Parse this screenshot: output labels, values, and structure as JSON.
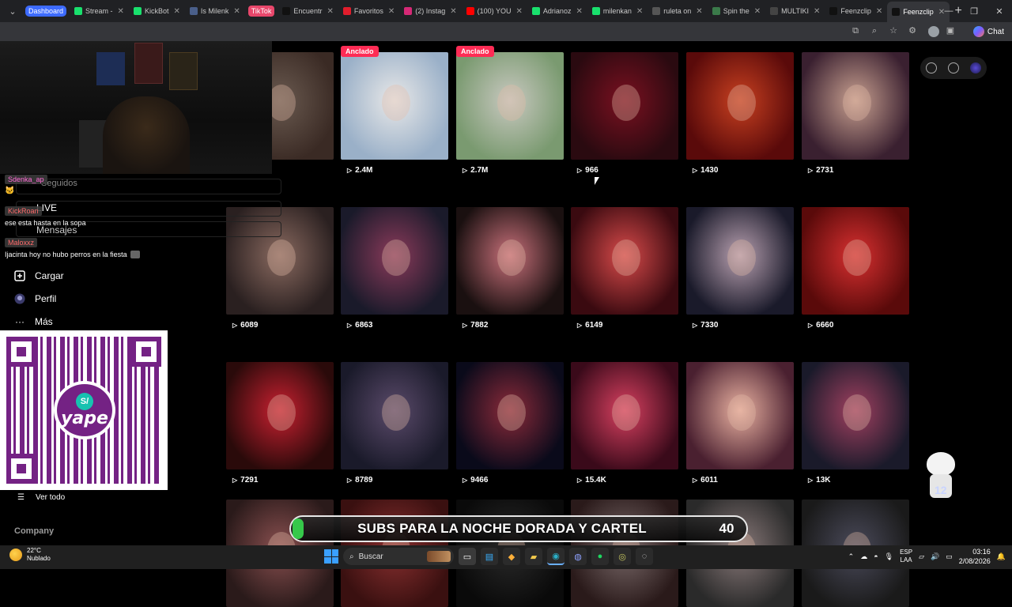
{
  "browser": {
    "tabs": [
      {
        "label": "Dashboard",
        "kind": "group",
        "color": "#3d6bff"
      },
      {
        "label": "Stream -",
        "fav": "#19e06d"
      },
      {
        "label": "KickBot",
        "fav": "#19e06d"
      },
      {
        "label": "Is Milenk",
        "fav": "#4a5f8a"
      },
      {
        "label": "TikTok",
        "kind": "tiktok",
        "color": "#e8476b"
      },
      {
        "label": "Encuentr",
        "fav": "#111111"
      },
      {
        "label": "Favoritos",
        "fav": "#e11d2c"
      },
      {
        "label": "(2) Instag",
        "fav": "#d62976"
      },
      {
        "label": "(100) YOU",
        "fav": "#ff0000"
      },
      {
        "label": "Adrianoz",
        "fav": "#19e06d"
      },
      {
        "label": "milenkan",
        "fav": "#19e06d"
      },
      {
        "label": "ruleta on",
        "fav": "#555555"
      },
      {
        "label": "Spin the",
        "fav": "#3b7a4a"
      },
      {
        "label": "MULTIKI",
        "fav": "#444444"
      },
      {
        "label": "Feenzclip",
        "fav": "#111111"
      },
      {
        "label": "Feenzclip",
        "fav": "#111111",
        "active": true
      }
    ],
    "toolbar": {
      "chat_label": "Chat"
    }
  },
  "sidebar": {
    "ghost_labels": [
      "Seguidos",
      "LIVE",
      "Mensajes"
    ],
    "items": [
      {
        "label": "Cargar",
        "icon": "plus-square-icon"
      },
      {
        "label": "Perfil",
        "icon": "avatar-icon"
      },
      {
        "label": "Más",
        "icon": "more-icon"
      }
    ],
    "see_all": "Ver todo",
    "company": "Company"
  },
  "stream_chat": [
    {
      "user": "Sdenka_ap",
      "user_color": "#ff6bd6",
      "message": ""
    },
    {
      "user": "KickRoan",
      "user_color": "#ff6b6b",
      "message": "ese esta hasta en la sopa"
    },
    {
      "user": "Maloxxz",
      "user_color": "#ff6b6b",
      "message": "Ijacinta hoy no hubo perros en la fiesta"
    }
  ],
  "donation": {
    "brand": "yape",
    "brand_color": "#742284"
  },
  "videos": [
    {
      "views": "",
      "pinned": false,
      "caption": "",
      "tone": [
        "#3a2a24",
        "#6a5a50"
      ]
    },
    {
      "views": "2.4M",
      "pinned": true,
      "pinned_label": "Anclado",
      "caption": "",
      "tone": [
        "#9ab0c8",
        "#e8e8e8"
      ]
    },
    {
      "views": "2.7M",
      "pinned": true,
      "pinned_label": "Anclado",
      "caption": "",
      "tone": [
        "#7a9a70",
        "#c8c8c0"
      ]
    },
    {
      "views": "966",
      "pinned": false,
      "caption": "",
      "tone": [
        "#2a0a10",
        "#7a1020"
      ]
    },
    {
      "views": "1430",
      "pinned": false,
      "caption": "",
      "tone": [
        "#5a0a0a",
        "#c84020"
      ]
    },
    {
      "views": "2731",
      "pinned": false,
      "caption": "",
      "tone": [
        "#3a2030",
        "#c8a090"
      ]
    },
    {
      "views": "6089",
      "pinned": false,
      "caption": "",
      "tone": [
        "#2a2020",
        "#8a6a60"
      ]
    },
    {
      "views": "6863",
      "pinned": false,
      "caption": "",
      "tone": [
        "#1a1a2a",
        "#8a3a5a"
      ]
    },
    {
      "views": "7882",
      "pinned": false,
      "caption": "",
      "tone": [
        "#1a1010",
        "#c8707a"
      ]
    },
    {
      "views": "6149",
      "pinned": false,
      "caption": "",
      "tone": [
        "#3a0a10",
        "#d84a4a"
      ]
    },
    {
      "views": "7330",
      "pinned": false,
      "caption": "",
      "tone": [
        "#1a1a2a",
        "#b8a0b0"
      ]
    },
    {
      "views": "6660",
      "pinned": false,
      "caption": "",
      "tone": [
        "#5a0a0a",
        "#d83030"
      ]
    },
    {
      "views": "7291",
      "pinned": false,
      "caption": "",
      "tone": [
        "#2a0a0a",
        "#c82030"
      ]
    },
    {
      "views": "8789",
      "pinned": false,
      "caption": "",
      "tone": [
        "#1a1a2a",
        "#5a4a6a"
      ]
    },
    {
      "views": "9466",
      "pinned": false,
      "caption": "",
      "tone": [
        "#0a0a1a",
        "#8a2a3a"
      ]
    },
    {
      "views": "15.4K",
      "pinned": false,
      "caption": "",
      "tone": [
        "#3a0a1a",
        "#d84060"
      ]
    },
    {
      "views": "6011",
      "pinned": false,
      "caption": "",
      "tone": [
        "#4a2030",
        "#e8b0a0"
      ]
    },
    {
      "views": "13K",
      "pinned": false,
      "caption": "",
      "tone": [
        "#1a1a2a",
        "#a04060"
      ]
    },
    {
      "views": "",
      "pinned": false,
      "caption": "",
      "tone": [
        "#2a1a1a",
        "#8a5050"
      ]
    },
    {
      "views": "",
      "pinned": false,
      "caption": "",
      "tone": [
        "#3a1010",
        "#8a3030"
      ]
    },
    {
      "views": "",
      "pinned": false,
      "caption": "",
      "tone": [
        "#0a0a0a",
        "#2a2a2a"
      ]
    },
    {
      "views": "",
      "pinned": false,
      "caption": "",
      "tone": [
        "#2a1a1a",
        "#7a6a6a"
      ]
    },
    {
      "views": "",
      "pinned": false,
      "caption": "",
      "tone": [
        "#2a2a2a",
        "#8a7a7a"
      ]
    },
    {
      "views": "",
      "pinned": false,
      "caption": "",
      "tone": [
        "#1a1a1a",
        "#4a4a5a"
      ]
    }
  ],
  "subs_goal": {
    "text": "SUBS PARA LA NOCHE DORADA Y CARTEL",
    "count": "40",
    "bar_color": "#36c84a"
  },
  "taskbar": {
    "weather_temp": "22°C",
    "weather_desc": "Nublado",
    "search_placeholder": "Buscar",
    "lang_top": "ESP",
    "lang_bottom": "LAA",
    "time": "03:16",
    "date": "2/08/2026"
  }
}
